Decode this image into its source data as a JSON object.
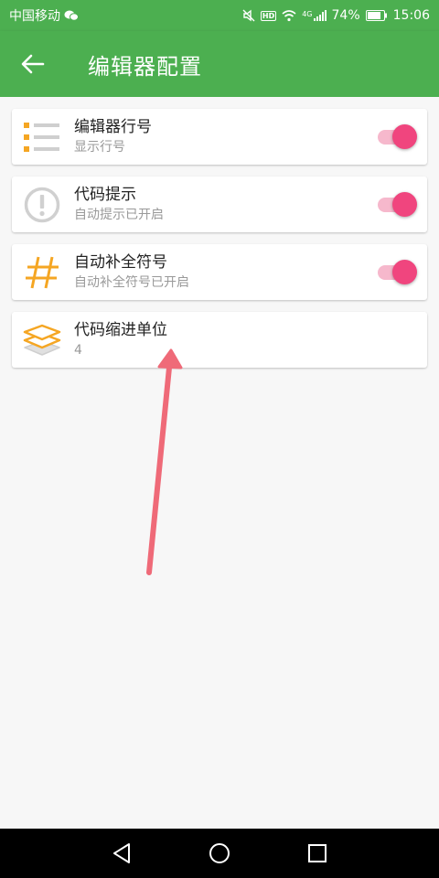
{
  "status_bar": {
    "carrier": "中国移动",
    "hd_badge": "HD",
    "network": "4G",
    "battery": "74%",
    "time": "15:06"
  },
  "app_bar": {
    "title": "编辑器配置"
  },
  "settings": [
    {
      "title": "编辑器行号",
      "subtitle": "显示行号",
      "icon": "line-number-icon",
      "toggle": true
    },
    {
      "title": "代码提示",
      "subtitle": "自动提示已开启",
      "icon": "exclamation-circle-icon",
      "toggle": true
    },
    {
      "title": "自动补全符号",
      "subtitle": "自动补全符号已开启",
      "icon": "hash-icon",
      "toggle": true
    },
    {
      "title": "代码缩进单位",
      "subtitle": "4",
      "icon": "layers-icon",
      "toggle": null
    }
  ],
  "colors": {
    "primary": "#4caf50",
    "accent": "#f0457e",
    "icon_orange": "#f5a623",
    "annotation_arrow": "#ef6a78"
  }
}
